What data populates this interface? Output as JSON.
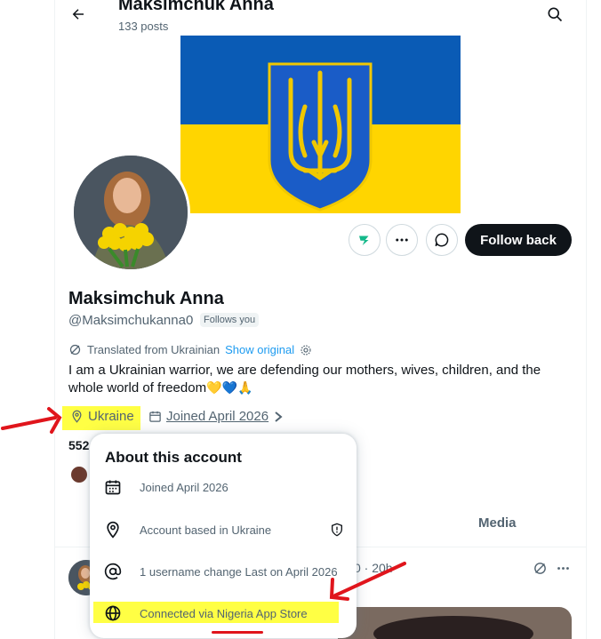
{
  "header": {
    "title": "Maksimchuk Anna",
    "subtitle": "133 posts"
  },
  "profile": {
    "name": "Maksimchuk Anna",
    "handle": "@Maksimchukanna0",
    "follows_you": "Follows you",
    "translated_label": "Translated from Ukrainian",
    "show_original": "Show original",
    "bio_line1": "I am a Ukrainian warrior, we are defending our mothers, wives, children, and the",
    "bio_line2": "whole world of freedom",
    "bio_emoji": "💛💙🙏",
    "location": "Ukraine",
    "joined": "Joined April 2026",
    "stats_partial": "552"
  },
  "actions": {
    "follow_back": "Follow back"
  },
  "tabs": {
    "media": "Media"
  },
  "post": {
    "meta_partial": "0 · 20h"
  },
  "popup": {
    "title": "About this account",
    "rows": [
      {
        "icon": "calendar-icon",
        "text": "Joined April 2026"
      },
      {
        "icon": "location-pin-icon",
        "text": "Account based in Ukraine"
      },
      {
        "icon": "at-sign-icon",
        "text": "1 username change Last on April 2026"
      },
      {
        "icon": "globe-icon",
        "text": "Connected via Nigeria App Store"
      }
    ]
  },
  "colors": {
    "accent": "#1d9bf0",
    "flag_blue": "#0a5bb5",
    "flag_yellow": "#ffd500",
    "highlight": "#ffff44",
    "annotation_red": "#e0151c"
  }
}
